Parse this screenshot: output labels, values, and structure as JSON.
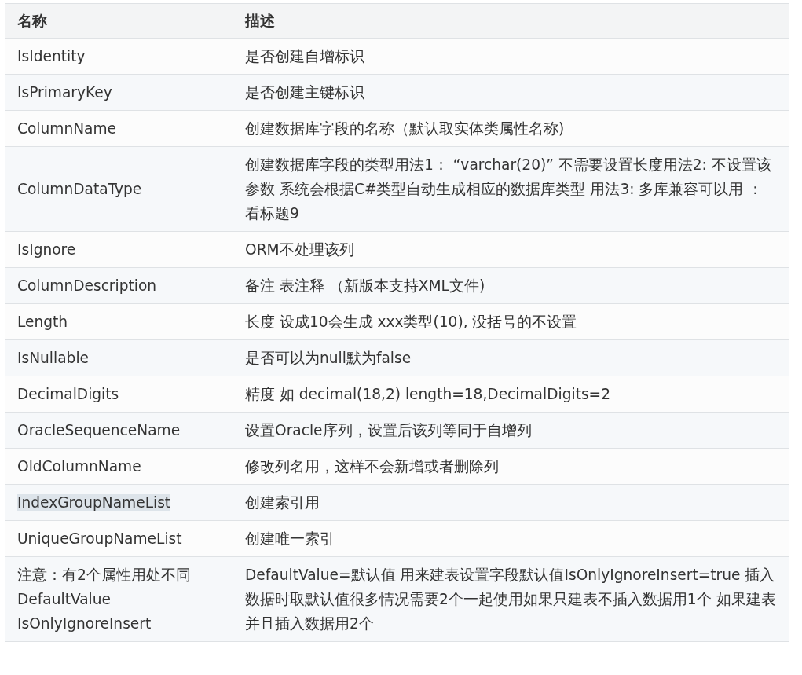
{
  "table": {
    "columns": [
      "名称",
      "描述"
    ],
    "rows": [
      {
        "name": "IsIdentity",
        "description": "是否创建自增标识",
        "highlighted": false
      },
      {
        "name": "IsPrimaryKey",
        "description": "是否创建主键标识",
        "highlighted": false
      },
      {
        "name": "ColumnName",
        "description": "创建数据库字段的名称（默认取实体类属性名称)",
        "highlighted": false
      },
      {
        "name": "ColumnDataType",
        "description": "创建数据库字段的类型用法1：  “varchar(20)” 不需要设置长度用法2:  不设置该参数  系统会根据C#类型自动生成相应的数据库类型 用法3:    多库兼容可以用 ：看标题9",
        "highlighted": false
      },
      {
        "name": "IsIgnore",
        "description": "ORM不处理该列",
        "highlighted": false
      },
      {
        "name": "ColumnDescription",
        "description": "备注 表注释  （新版本支持XML文件)",
        "highlighted": false
      },
      {
        "name": "Length",
        "description": "长度 设成10会生成  xxx类型(10), 没括号的不设置",
        "highlighted": false
      },
      {
        "name": "IsNullable",
        "description": "是否可以为null默为false",
        "highlighted": false
      },
      {
        "name": "DecimalDigits",
        "description": "精度 如 decimal(18,2) length=18,DecimalDigits=2",
        "highlighted": false
      },
      {
        "name": "OracleSequenceName",
        "description": "设置Oracle序列，设置后该列等同于自增列",
        "highlighted": false
      },
      {
        "name": "OldColumnName",
        "description": "修改列名用，这样不会新增或者删除列",
        "highlighted": false
      },
      {
        "name": "IndexGroupNameList",
        "description": "创建索引用",
        "highlighted": true
      },
      {
        "name": "UniqueGroupNameList",
        "description": "创建唯一索引",
        "highlighted": false
      },
      {
        "name": "注意：有2个属性用处不同DefaultValue IsOnlyIgnoreInsert",
        "description": "DefaultValue=默认值 用来建表设置字段默认值IsOnlyIgnoreInsert=true 插入数据时取默认值很多情况需要2个一起使用如果只建表不插入数据用1个 如果建表并且插入数据用2个",
        "highlighted": false
      }
    ]
  }
}
